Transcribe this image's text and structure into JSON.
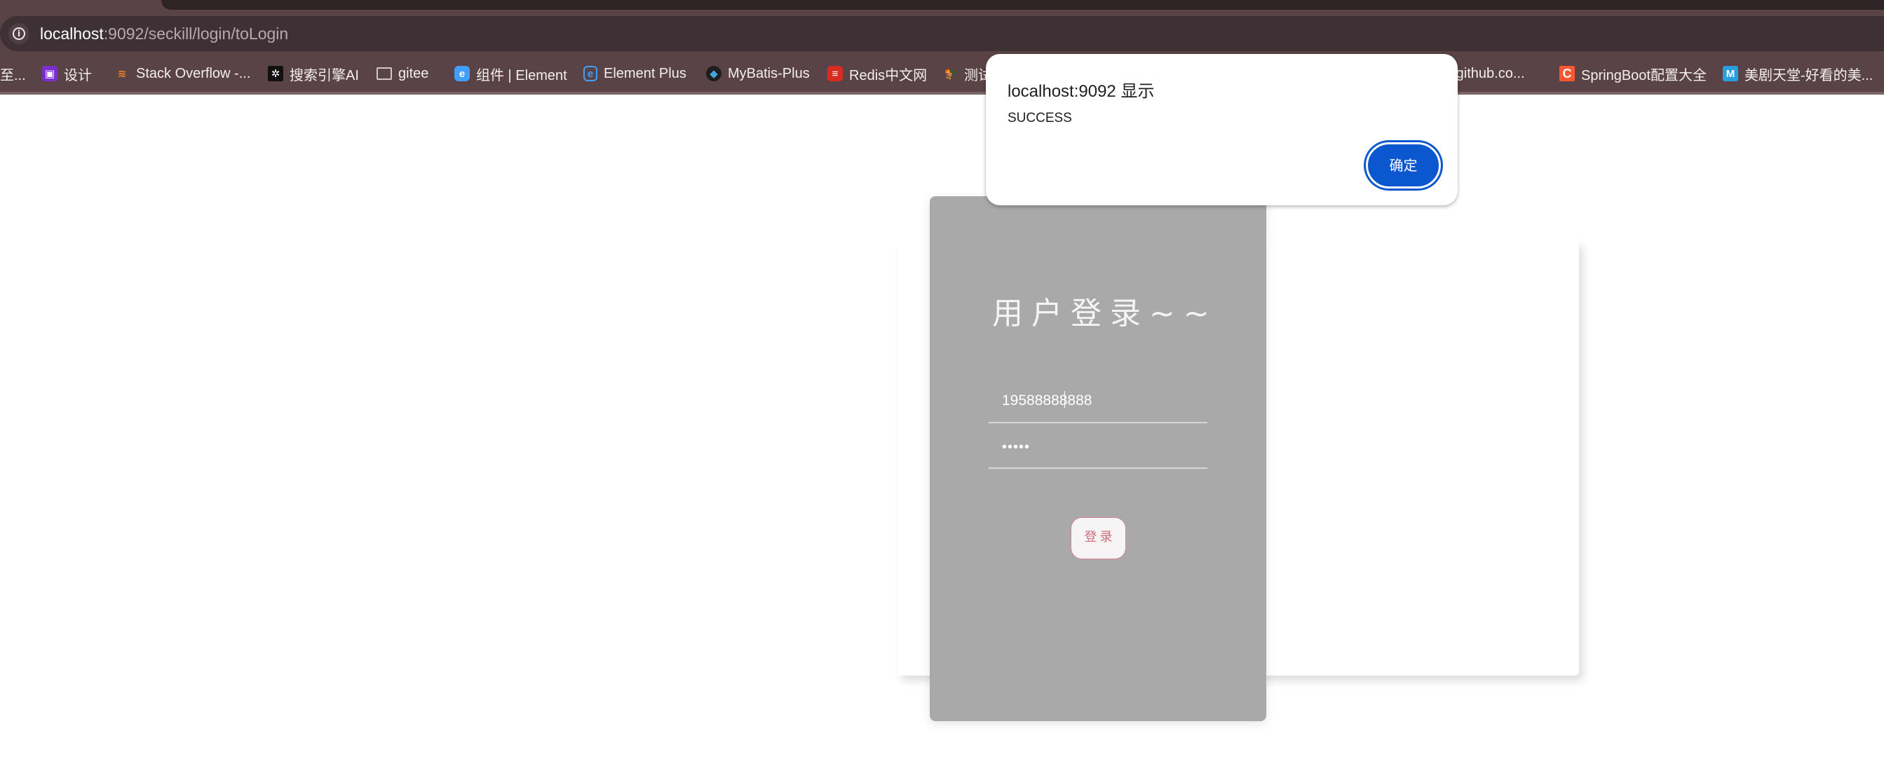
{
  "browser": {
    "url_host": "localhost",
    "url_path": ":9092/seckill/login/toLogin",
    "bookmarks": [
      {
        "label": "至...",
        "icon": "none",
        "icon_color": ""
      },
      {
        "label": "设计",
        "icon": "design-icon",
        "icon_color": "#7b2fd1"
      },
      {
        "label": "Stack Overflow -...",
        "icon": "stackoverflow-icon",
        "icon_color": "#f48024"
      },
      {
        "label": "搜索引擎AI",
        "icon": "search-ai-icon",
        "icon_color": "#111111"
      },
      {
        "label": "gitee",
        "icon": "folder-icon",
        "icon_color": "#cccccc"
      },
      {
        "label": "组件 | Element",
        "icon": "element-icon",
        "icon_color": "#409eff"
      },
      {
        "label": "Element Plus",
        "icon": "element-plus-icon",
        "icon_color": "#409eff"
      },
      {
        "label": "MyBatis-Plus",
        "icon": "mybatis-plus-icon",
        "icon_color": "#1e1e1e"
      },
      {
        "label": "Redis中文网",
        "icon": "redis-icon",
        "icon_color": "#d82c20"
      },
      {
        "label": "测试",
        "icon": "rooster-icon",
        "icon_color": "#e08a2c"
      },
      {
        "label": "://github.co...",
        "icon": "none",
        "icon_color": ""
      },
      {
        "label": "SpringBoot配置大全",
        "icon": "c-logo-icon",
        "icon_color": "#fc5531"
      },
      {
        "label": "美剧天堂-好看的美...",
        "icon": "m-logo-icon",
        "icon_color": "#2a9fe0"
      }
    ]
  },
  "login": {
    "title": "用户登录~~",
    "phone_value": "19588888888",
    "password_value": "12345",
    "submit_label": "登录",
    "colors": {
      "panel": "#a9a9a9",
      "button_border": "#d98592",
      "button_text": "#cd6d7c"
    }
  },
  "alert": {
    "title": "localhost:9092 显示",
    "message": "SUCCESS",
    "ok_label": "确定",
    "accent": "#0b57d0"
  }
}
